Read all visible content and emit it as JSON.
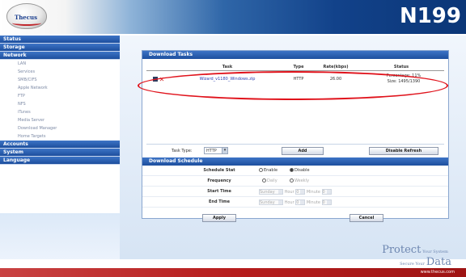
{
  "brand": {
    "logo_text": "Thecus",
    "model": "N199",
    "url": "www.thecus.com"
  },
  "nav": {
    "groups": [
      {
        "label": "Status",
        "items": []
      },
      {
        "label": "Storage",
        "items": []
      },
      {
        "label": "Network",
        "items": [
          "LAN",
          "Services",
          "SMB/CIFS",
          "Apple Network",
          "FTP",
          "NFS",
          "iTunes",
          "Media Server",
          "Download Manager",
          "Home Targets"
        ]
      },
      {
        "label": "Accounts",
        "items": []
      },
      {
        "label": "System",
        "items": []
      },
      {
        "label": "Language",
        "items": []
      }
    ]
  },
  "download_tasks": {
    "title": "Download Tasks",
    "columns": [
      "",
      "Task",
      "Type",
      "Rate(kbps)",
      "Status"
    ],
    "rows": [
      {
        "file": "Wizard_v1180_Windows.zip",
        "type": "HTTP",
        "rate": "26.00",
        "status_pct": "Percentage: 11%",
        "status_size": "Size: 1495/1390"
      }
    ],
    "task_type_label": "Task Type:",
    "task_type_value": "HTTP",
    "add_label": "Add",
    "disable_refresh_label": "Disable Refresh"
  },
  "download_schedule": {
    "title": "Download Schedule",
    "schedule_stat_label": "Schedule Stat",
    "enable_label": "Enable",
    "disable_label": "Disable",
    "frequency_label": "Frequency",
    "daily_label": "Daily",
    "weekly_label": "Weekly",
    "start_time_label": "Start Time",
    "end_time_label": "End Time",
    "day_value": "Sunday",
    "hour_label": "Hour",
    "hour_value": "0",
    "minute_label": "Minute",
    "minute_value": "0",
    "apply_label": "Apply",
    "cancel_label": "Cancel"
  },
  "footer": {
    "protect": "Protect",
    "your_system": "Your System",
    "secure_your": "Secure Your",
    "data": "Data"
  },
  "colors": {
    "header_blue": "#1d4f9e",
    "highlight_red": "#e0121b",
    "footer_red": "#b61d1d"
  }
}
